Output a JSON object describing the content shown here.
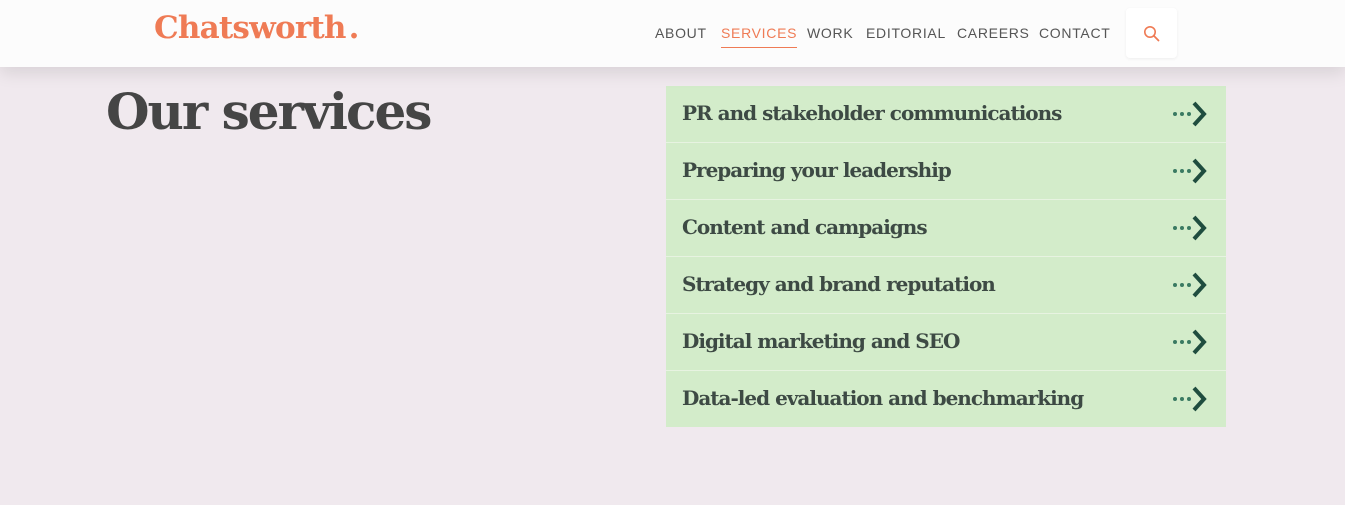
{
  "header": {
    "logo": "Chatsworth",
    "nav": [
      {
        "label": "ABOUT"
      },
      {
        "label": "SERVICES",
        "active": true
      },
      {
        "label": "WORK"
      },
      {
        "label": "EDITORIAL"
      },
      {
        "label": "CAREERS"
      },
      {
        "label": "CONTACT"
      }
    ],
    "search_icon": "search-icon"
  },
  "page": {
    "title": "Our services"
  },
  "services": [
    {
      "label": "PR and stakeholder communications",
      "icon": "dotted-arrow-right-icon"
    },
    {
      "label": "Preparing your leadership",
      "icon": "dotted-arrow-right-icon"
    },
    {
      "label": "Content and campaigns",
      "icon": "dotted-arrow-right-icon"
    },
    {
      "label": "Strategy and brand reputation",
      "icon": "dotted-arrow-right-icon"
    },
    {
      "label": "Digital marketing and SEO",
      "icon": "dotted-arrow-right-icon"
    },
    {
      "label": "Data-led evaluation and benchmarking",
      "icon": "dotted-arrow-right-icon"
    }
  ],
  "colors": {
    "brand": "#ef7b55",
    "background": "#f0e9ee",
    "service_bg": "#d3ecca",
    "arrow": "#1f4d3f",
    "text": "#454545"
  }
}
